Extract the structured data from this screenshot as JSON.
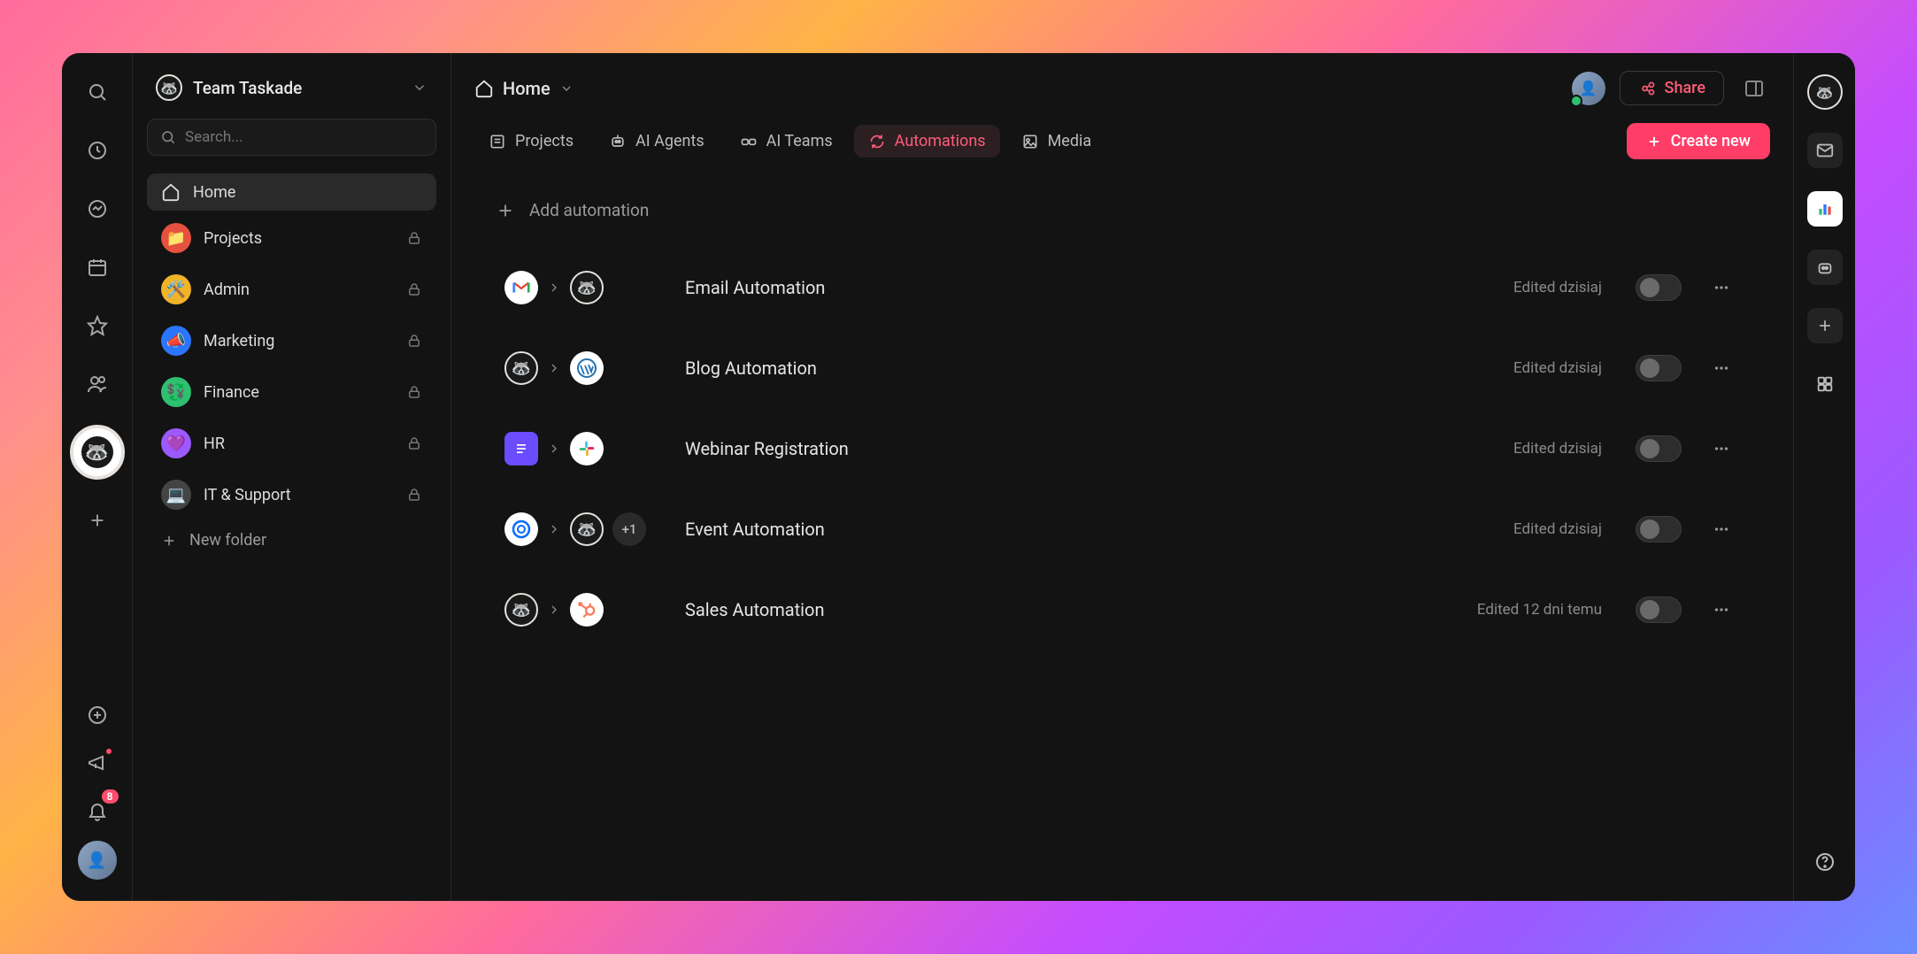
{
  "workspace": {
    "name": "Team Taskade"
  },
  "search": {
    "placeholder": "Search..."
  },
  "sidebar": {
    "home_label": "Home",
    "folders": [
      {
        "label": "Projects",
        "icon": "📁",
        "color": "fi-red"
      },
      {
        "label": "Admin",
        "icon": "🛠️",
        "color": "fi-yellow"
      },
      {
        "label": "Marketing",
        "icon": "📣",
        "color": "fi-blue"
      },
      {
        "label": "Finance",
        "icon": "💱",
        "color": "fi-green"
      },
      {
        "label": "HR",
        "icon": "💜",
        "color": "fi-purple"
      },
      {
        "label": "IT & Support",
        "icon": "💻",
        "color": "fi-gray"
      }
    ],
    "new_folder_label": "New folder"
  },
  "breadcrumb": {
    "title": "Home"
  },
  "tabs": {
    "items": [
      {
        "label": "Projects"
      },
      {
        "label": "AI Agents"
      },
      {
        "label": "AI Teams"
      },
      {
        "label": "Automations"
      },
      {
        "label": "Media"
      }
    ],
    "active_index": 3
  },
  "actions": {
    "share_label": "Share",
    "create_label": "Create new",
    "add_automation_label": "Add automation"
  },
  "notifications": {
    "count": "8"
  },
  "automations": [
    {
      "name": "Email Automation",
      "edited": "Edited dzisiaj",
      "from": "gmail",
      "to": "taskade",
      "extra": null
    },
    {
      "name": "Blog Automation",
      "edited": "Edited dzisiaj",
      "from": "taskade",
      "to": "wordpress",
      "extra": null
    },
    {
      "name": "Webinar Registration",
      "edited": "Edited dzisiaj",
      "from": "form",
      "to": "slack",
      "extra": null
    },
    {
      "name": "Event Automation",
      "edited": "Edited dzisiaj",
      "from": "calendly",
      "to": "taskade",
      "extra": "+1"
    },
    {
      "name": "Sales Automation",
      "edited": "Edited 12 dni temu",
      "from": "taskade",
      "to": "hubspot",
      "extra": null
    }
  ]
}
